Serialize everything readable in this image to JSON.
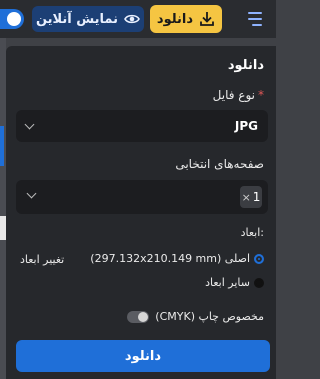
{
  "topbar": {
    "online_label": "نمایش آنلاین",
    "download_label": "دانلود",
    "icons": {
      "eye": "eye-icon",
      "download": "download-icon",
      "menu": "hamburger-menu-icon"
    },
    "colors": {
      "online_bg": "#1c3f75",
      "download_bg": "#f5c542",
      "accent": "#1f6fd8"
    }
  },
  "panel": {
    "title": "دانلود",
    "file_type": {
      "label": "نوع فایل",
      "required_mark": "*",
      "value": "JPG"
    },
    "pages": {
      "label": "صفحه‌های انتخابی",
      "selected": [
        "1"
      ],
      "remove_glyph": "×"
    },
    "dimensions": {
      "label": "ابعاد:",
      "options": [
        {
          "label": "اصلی (297.132x210.149 mm)",
          "selected": true
        },
        {
          "label": "سایر ابعاد",
          "selected": false
        }
      ],
      "change_link": "تغییر ابعاد"
    },
    "cmyk": {
      "label": "مخصوص چاپ (CMYK)",
      "enabled": false
    },
    "submit_label": "دانلود"
  }
}
